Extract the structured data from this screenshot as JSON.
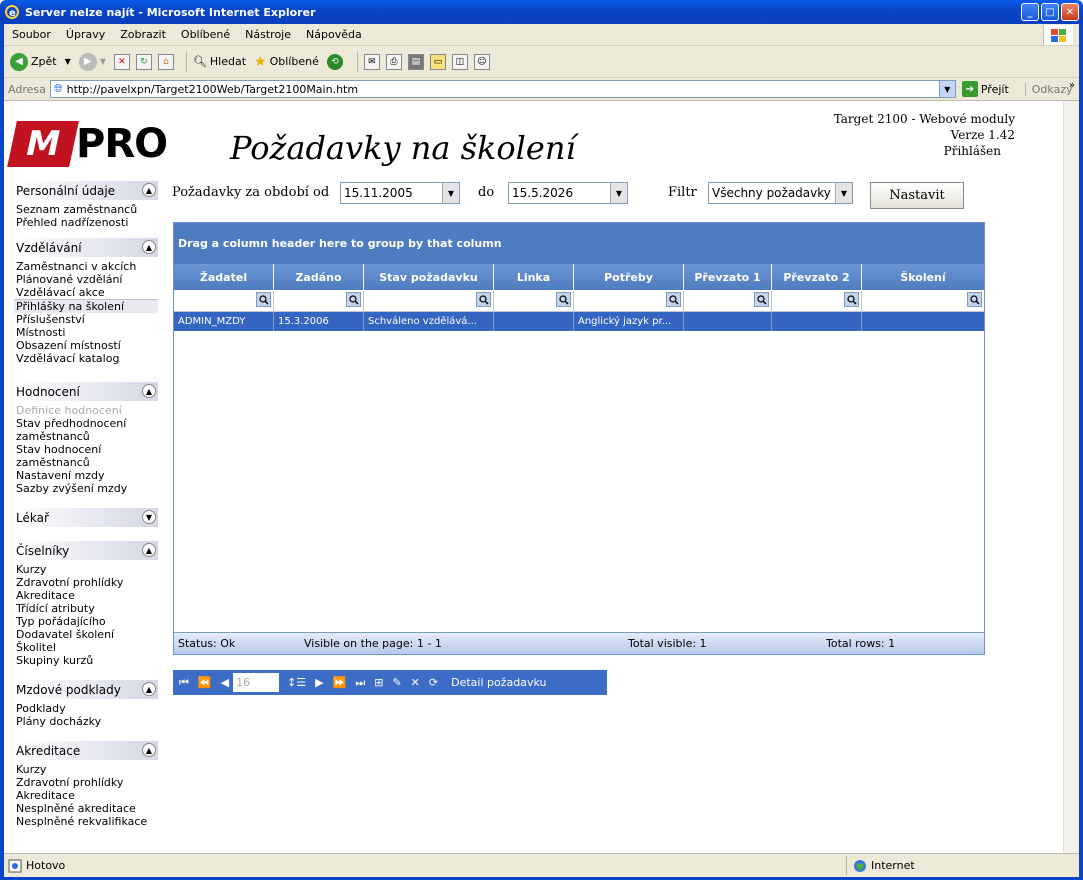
{
  "window": {
    "title": "Server nelze najít - Microsoft Internet Explorer"
  },
  "menu": [
    "Soubor",
    "Úpravy",
    "Zobrazit",
    "Oblíbené",
    "Nástroje",
    "Nápověda"
  ],
  "toolbar": {
    "back": "Zpět",
    "search": "Hledat",
    "favorites": "Oblíbené"
  },
  "address": {
    "label": "Adresa",
    "url": "http://pavelxpn/Target2100Web/Target2100Main.htm",
    "go": "Přejít",
    "links": "Odkazy"
  },
  "header": {
    "title": "Požadavky na školení",
    "info": [
      "Target 2100 - Webové moduly",
      "Verze 1.42",
      "Přihlášen"
    ]
  },
  "sidebar": [
    {
      "title": "Personální údaje",
      "items": [
        "Seznam zaměstnanců",
        "Přehled nadřízenosti"
      ]
    },
    {
      "title": "Vzdělávání",
      "items": [
        "Zaměstnanci v akcích",
        "Plánované vzdělání",
        "Vzdělávací akce",
        "Přihlášky na školení",
        "Příslušenství",
        "Místnosti",
        "Obsazení místností",
        "Vzdělávací katalog"
      ]
    },
    {
      "title": "Hodnocení",
      "items": [
        "Definice hodnocení",
        "Stav předhodnocení",
        "zaměstnanců",
        "Stav hodnocení",
        "zaměstnanců",
        "Nastavení mzdy",
        "Sazby zvýšení mzdy"
      ]
    },
    {
      "title": "Lékař",
      "items": []
    },
    {
      "title": "Číselníky",
      "items": [
        "Kurzy",
        "Zdravotní prohlídky",
        "Akreditace",
        "Třídící atributy",
        "Typ pořádajícího",
        "Dodavatel školení",
        "Školitel",
        "Skupiny kurzů"
      ]
    },
    {
      "title": "Mzdové podklady",
      "items": [
        "Podklady",
        "Plány docházky"
      ]
    },
    {
      "title": "Akreditace",
      "items": [
        "Kurzy",
        "Zdravotní prohlídky",
        "Akreditace",
        "Nesplněné akreditace",
        "Nesplněné rekvalifikace"
      ]
    }
  ],
  "filter": {
    "period_label": "Požadavky za období od",
    "from": "15.11.2005",
    "to_label": "do",
    "to": "15.5.2026",
    "filter_label": "Filtr",
    "filter_value": "Všechny požadavky",
    "set_button": "Nastavit"
  },
  "grid": {
    "group_hint": "Drag a column header here to group by that column",
    "columns": [
      "Žadatel",
      "Zadáno",
      "Stav požadavku",
      "Linka",
      "Potřeby",
      "Převzato 1",
      "Převzato 2",
      "Školení"
    ],
    "rows": [
      [
        "ADMIN_MZDY",
        "15.3.2006",
        "Schváleno vzdělává...",
        "",
        "Anglický jazyk pr...",
        "",
        "",
        ""
      ]
    ],
    "status": {
      "status": "Status: Ok",
      "visible": "Visible on the page: 1 - 1",
      "total_visible": "Total visible: 1",
      "total_rows": "Total rows: 1"
    }
  },
  "pager": {
    "page_size": "16",
    "detail": "Detail požadavku"
  },
  "statusbar": {
    "text": "Hotovo",
    "zone": "Internet"
  }
}
